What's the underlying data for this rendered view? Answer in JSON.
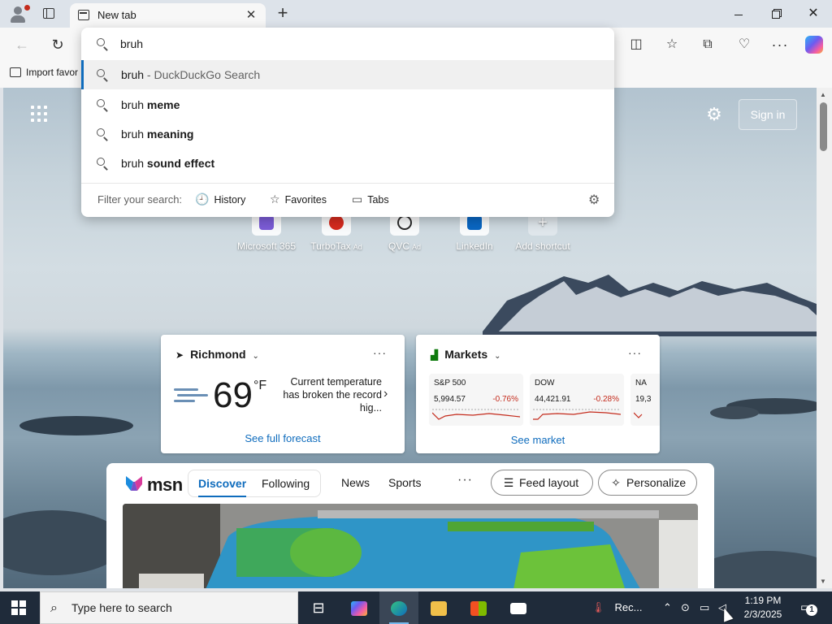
{
  "browser": {
    "tab": {
      "title": "New tab",
      "close_glyph": "✕"
    },
    "new_tab_glyph": "+",
    "window_controls": {
      "minimize": "minimize-icon",
      "maximize": "restore-icon",
      "close": "✕"
    },
    "toolbar": {
      "back_glyph": "←",
      "refresh_glyph": "↻",
      "split_glyph": "◫",
      "favorites_glyph": "☆",
      "collections_glyph": "⧉",
      "performance_glyph": "♡",
      "more_glyph": "···"
    },
    "favorites_bar": {
      "import_label": "Import favor"
    }
  },
  "omnibox": {
    "query": "bruh",
    "suggestions": [
      {
        "prefix": "bruh",
        "bold": "",
        "suffix": " - DuckDuckGo Search",
        "selected": true
      },
      {
        "prefix": "bruh ",
        "bold": "meme",
        "suffix": "",
        "selected": false
      },
      {
        "prefix": "bruh ",
        "bold": "meaning",
        "suffix": "",
        "selected": false
      },
      {
        "prefix": "bruh ",
        "bold": "sound effect",
        "suffix": "",
        "selected": false
      }
    ],
    "filter": {
      "label": "Filter your search:",
      "chips": [
        {
          "glyph": "🕘",
          "label": "History"
        },
        {
          "glyph": "☆",
          "label": "Favorites"
        },
        {
          "glyph": "▭",
          "label": "Tabs"
        }
      ],
      "settings_glyph": "⚙"
    }
  },
  "newtab": {
    "settings_glyph": "⚙",
    "sign_in": "Sign in",
    "shortcuts": [
      {
        "label": "Microsoft 365",
        "ad": "",
        "color": "#7b5cd6"
      },
      {
        "label": "TurboTax",
        "ad": "Ad",
        "color": "#d52b1e"
      },
      {
        "label": "QVC",
        "ad": "Ad",
        "color": "#2a2a2a"
      },
      {
        "label": "LinkedIn",
        "ad": "",
        "color": "#0a66c2"
      },
      {
        "label": "Add shortcut",
        "ad": "",
        "color": "#ffffff"
      }
    ],
    "weather": {
      "location": "Richmond",
      "temp": "69",
      "unit": "°F",
      "alert": "Current temperature has broken the record hig...",
      "link": "See full forecast",
      "more": "···"
    },
    "markets": {
      "title": "Markets",
      "more": "···",
      "link": "See market",
      "tiles": [
        {
          "name": "S&P 500",
          "value": "5,994.57",
          "change": "-0.76%"
        },
        {
          "name": "DOW",
          "value": "44,421.91",
          "change": "-0.28%"
        },
        {
          "name": "NA",
          "value": "19,3",
          "change": ""
        }
      ]
    },
    "feed": {
      "logo": "msn",
      "tabs": [
        {
          "label": "Discover",
          "active": true
        },
        {
          "label": "Following",
          "active": false
        }
      ],
      "links": [
        "News",
        "Sports"
      ],
      "more": "···",
      "feed_layout": "Feed layout",
      "personalize": "Personalize"
    }
  },
  "taskbar": {
    "search_placeholder": "Type here to search",
    "tray_app_label": "Rec...",
    "time": "1:19 PM",
    "date": "2/3/2025",
    "notification_count": "1"
  }
}
